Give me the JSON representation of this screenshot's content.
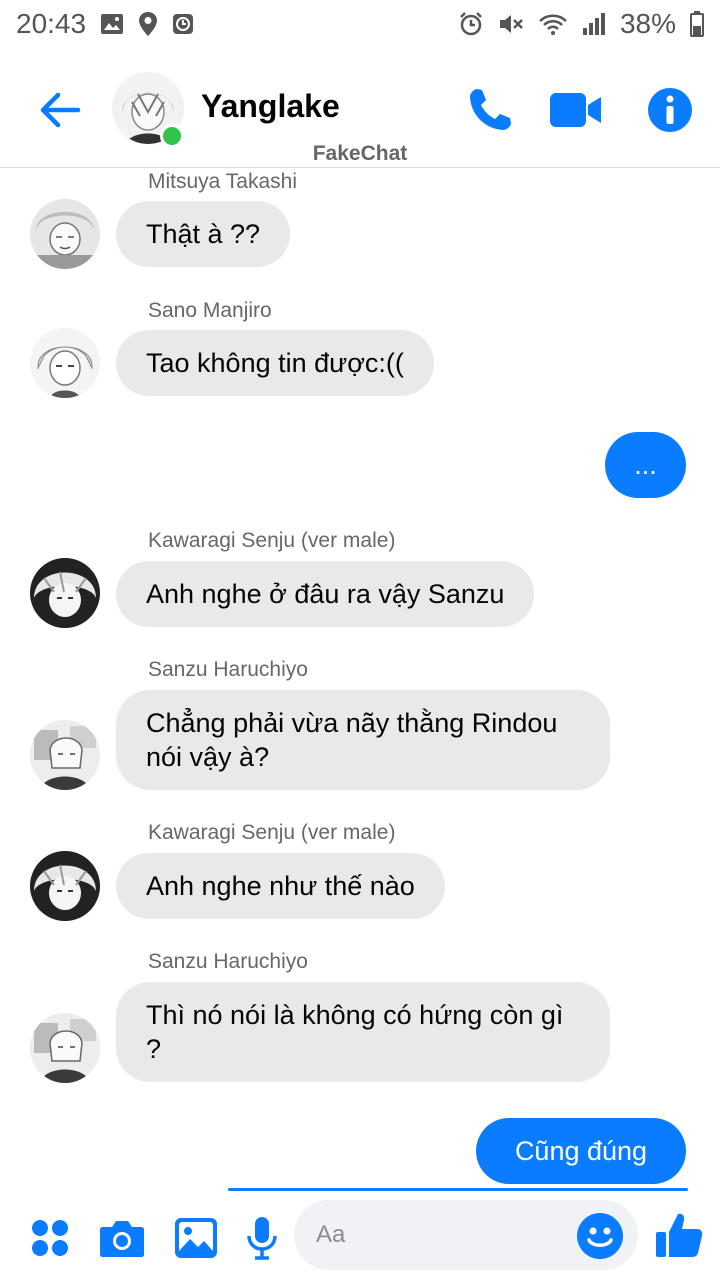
{
  "status_bar": {
    "time": "20:43",
    "battery": "38%"
  },
  "header": {
    "contact_name": "Yanglake",
    "watermark": "FakeChat"
  },
  "messages": [
    {
      "sender": "Mitsuya Takashi",
      "text": "Thật à ??"
    },
    {
      "sender": "Sano Manjiro",
      "text": "Tao không tin được:(("
    },
    {
      "outgoing": "..."
    },
    {
      "sender": "Kawaragi Senju (ver male)",
      "text": "Anh nghe ở đâu ra vậy Sanzu"
    },
    {
      "sender": "Sanzu Haruchiyo",
      "text": "Chẳng phải vừa nãy thằng Rindou nói vậy à?"
    },
    {
      "sender": "Kawaragi Senju (ver male)",
      "text": "Anh nghe như thế nào"
    },
    {
      "sender": "Sanzu Haruchiyo",
      "text": "Thì nó nói là không có hứng còn gì ?"
    },
    {
      "outgoing": "Cũng đúng"
    }
  ],
  "composer": {
    "placeholder": "Aa"
  },
  "colors": {
    "accent": "#0a7cff",
    "incoming_bubble": "#e9e9eb",
    "online": "#31c44a"
  }
}
